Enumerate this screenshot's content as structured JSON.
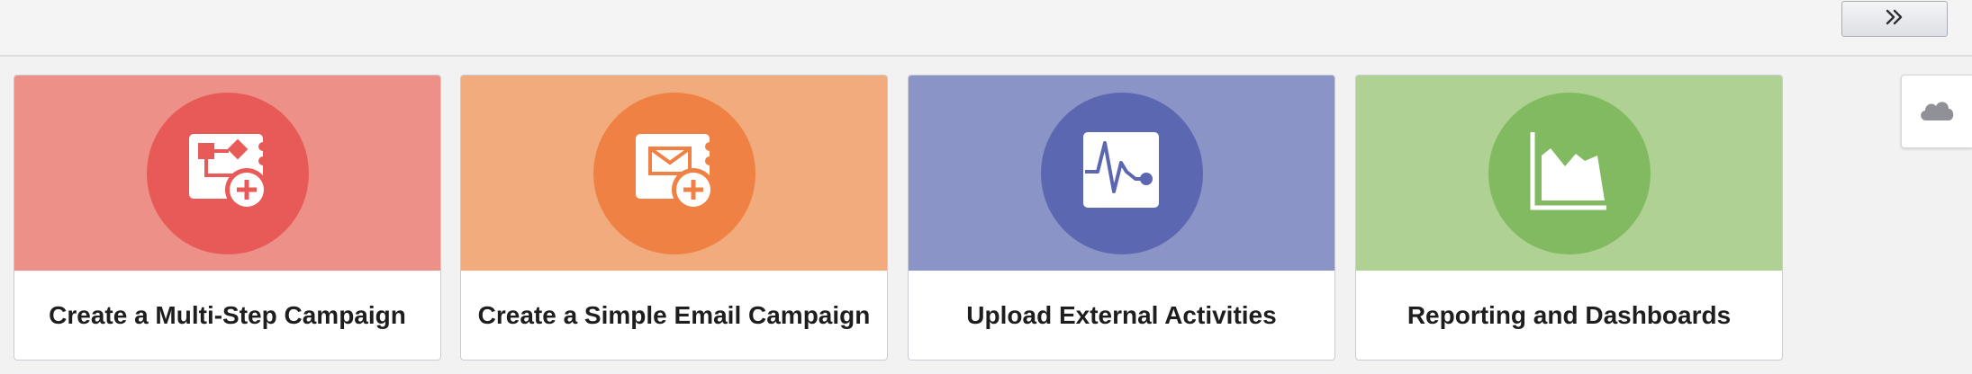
{
  "toolbar": {
    "expand_icon": "double-chevron-right-icon",
    "expand_glyph": "»"
  },
  "cards": [
    {
      "label": "Create a Multi-Step Campaign",
      "icon": "multi-step-campaign-add-icon",
      "band_color": "#ec9088",
      "circle_color": "#e85a57"
    },
    {
      "label": "Create a Simple Email Campaign",
      "icon": "email-campaign-add-icon",
      "band_color": "#f2ab7c",
      "circle_color": "#ee8143"
    },
    {
      "label": "Upload External Activities",
      "icon": "activity-pulse-icon",
      "band_color": "#8a94c6",
      "circle_color": "#5b67b0"
    },
    {
      "label": "Reporting and Dashboards",
      "icon": "area-chart-icon",
      "band_color": "#afd193",
      "circle_color": "#81ba60"
    }
  ],
  "side_tab": {
    "icon": "cloud-icon"
  }
}
